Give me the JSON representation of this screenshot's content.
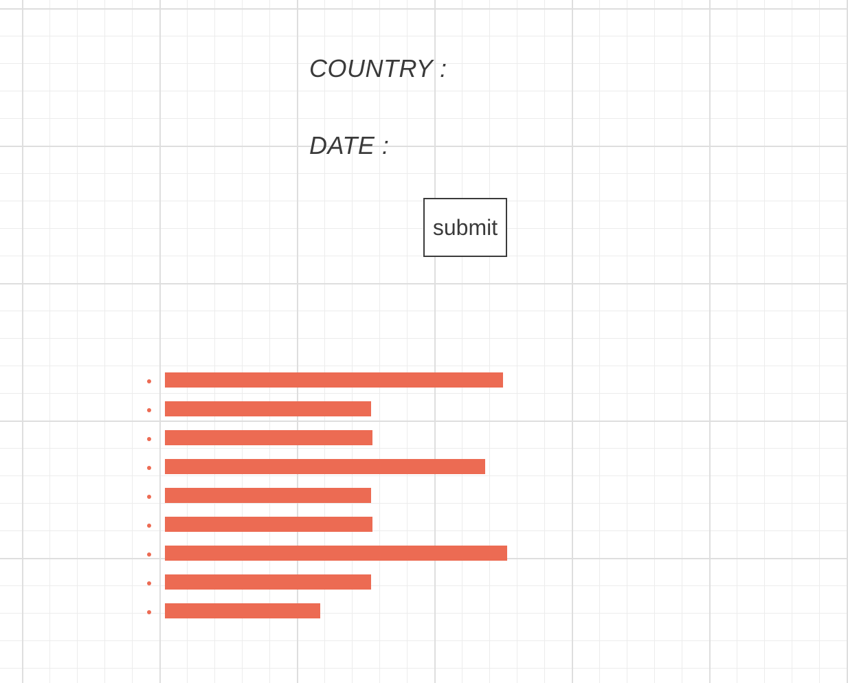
{
  "form": {
    "country_label": "COUNTRY :",
    "date_label": "DATE :",
    "submit_label": "submit"
  },
  "colors": {
    "bar": "#ec6b53",
    "text": "#3a3a3a",
    "grid": "#dedede"
  },
  "bars": {
    "values": [
      0.988,
      0.602,
      0.606,
      0.936,
      0.602,
      0.606,
      1.0,
      0.602,
      0.454
    ]
  }
}
